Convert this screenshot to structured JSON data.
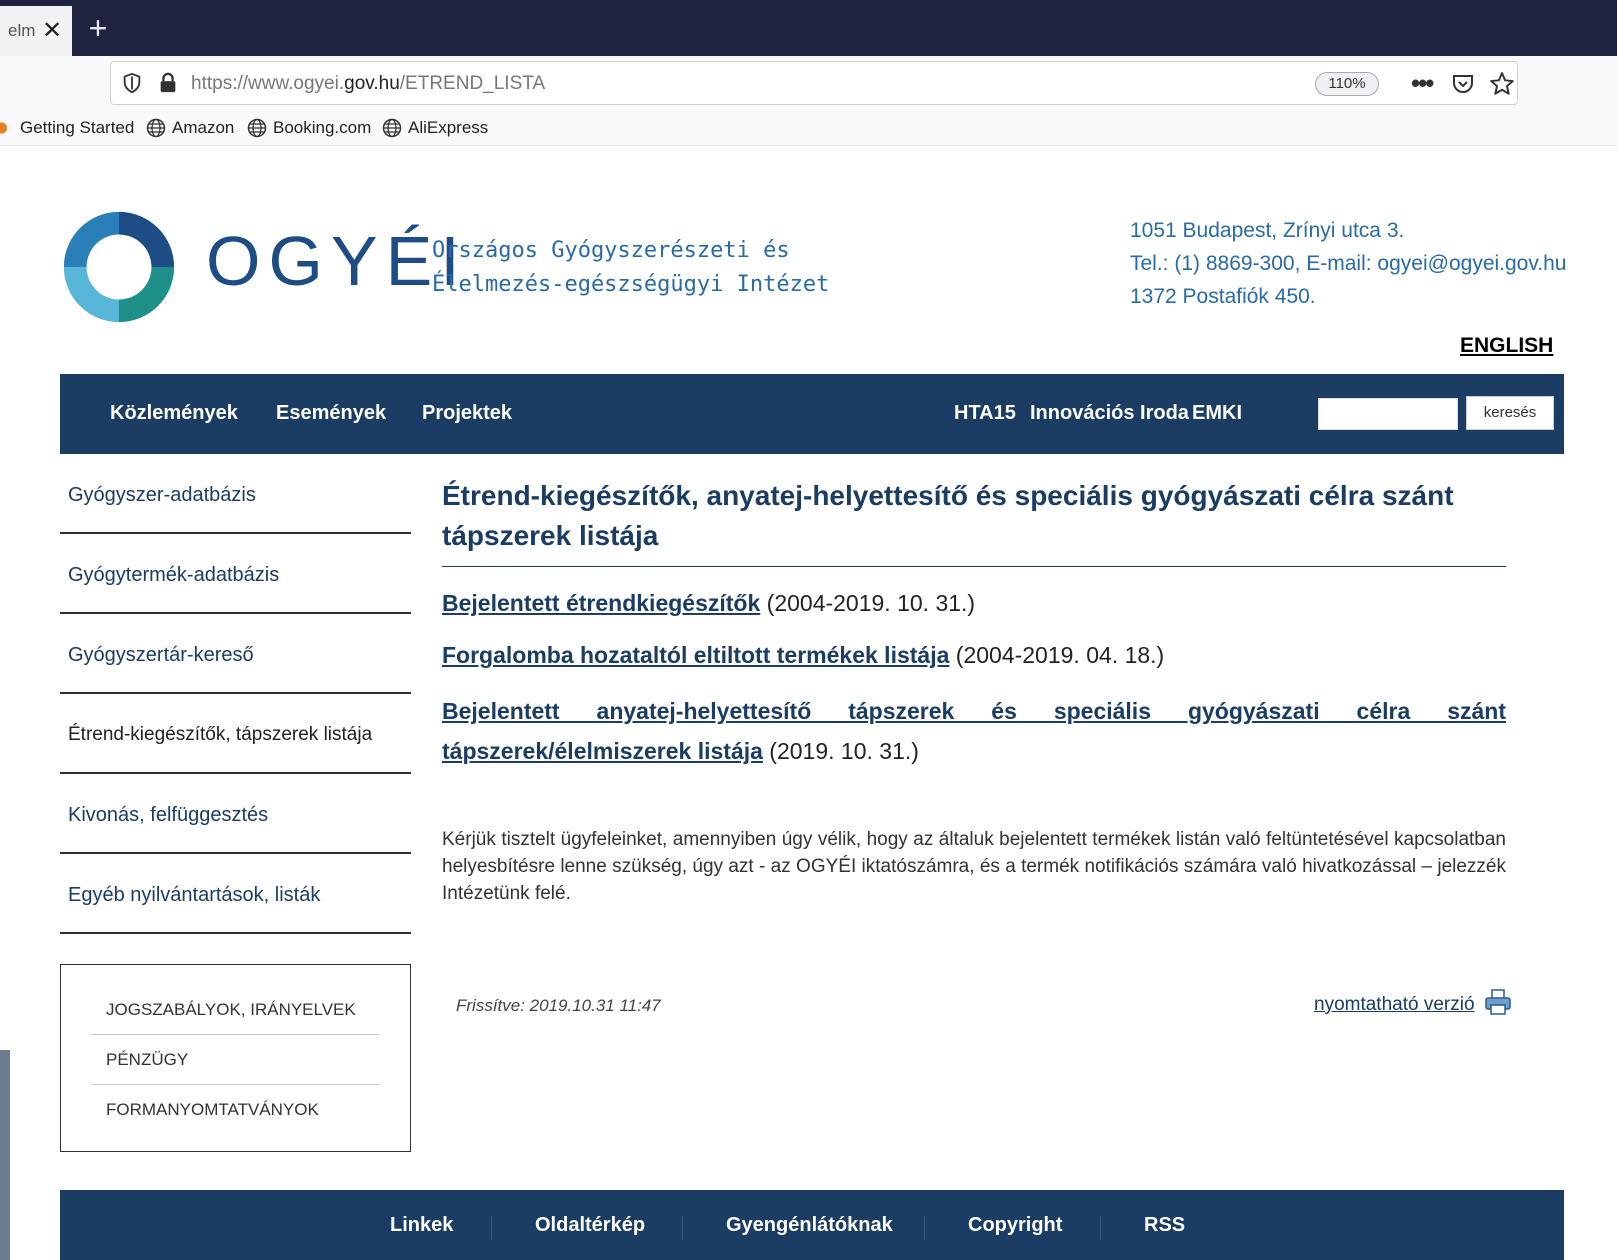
{
  "browser": {
    "tab_title": "elme",
    "url_prefix": "https://www.ogyei.",
    "url_domain": "gov.hu",
    "url_path": "/ETREND_LISTA",
    "zoom": "110%",
    "bookmarks": [
      "Getting Started",
      "Amazon",
      "Booking.com",
      "AliExpress"
    ]
  },
  "header": {
    "brand": "OGYÉI",
    "inst_line1": "Országos Gyógyszerészeti és",
    "inst_line2": "Élelmezés-egészségügyi Intézet",
    "address": "1051 Budapest, Zrínyi utca 3.",
    "phone_email": "Tel.: (1) 8869-300, E-mail: ogyei@ogyei.gov.hu",
    "postbox": "1372 Postafiók 450.",
    "english": "ENGLISH"
  },
  "nav": {
    "left": [
      "Közlemények",
      "Események",
      "Projektek"
    ],
    "right": [
      "HTA15",
      "Innovációs Iroda",
      "EMKI"
    ],
    "search_button": "keresés"
  },
  "sidebar": {
    "items": [
      "Gyógyszer-adatbázis",
      "Gyógytermék-adatbázis",
      "Gyógyszertár-kereső",
      "Étrend-kiegészítők, tápszerek listája",
      "Kivonás, felfüggesztés",
      "Egyéb nyilvántartások, listák"
    ],
    "box_items": [
      "JOGSZABÁLYOK, IRÁNYELVEK",
      "PÉNZÜGY",
      "FORMANYOMTATVÁNYOK"
    ]
  },
  "content": {
    "title": "Étrend-kiegészítők, anyatej-helyettesítő és speciális gyógyászati célra szánt tápszerek listája",
    "link1": "Bejelentett étrendkiegészítők",
    "link1_date": " (2004-2019. 10. 31.)",
    "link2": "Forgalomba hozataltól eltiltott termékek listája",
    "link2_date": " (2004-2019. 04. 18.)",
    "link3_line1": "Bejelentett anyatej-helyettesítő tápszerek és speciális gyógyászati célra szánt",
    "link3_line2": "tápszerek/élelmiszerek listája",
    "link3_date": " (2019. 10. 31.)",
    "notice": "Kérjük tisztelt ügyfeleinket, amennyiben úgy vélik, hogy az általuk bejelentett termékek listán való feltüntetésével kapcsolatban helyesbítésre lenne szükség, úgy azt - az OGYÉI iktatószámra, és a termék notifikációs számára való hivatkozással – jelezzék Intézetünk felé.",
    "updated": "Frissítve: 2019.10.31 11:47",
    "print": "nyomtatható verzió "
  },
  "footer": {
    "items": [
      "Linkek",
      "Oldaltérkép",
      "Gyengénlátóknak",
      "Copyright",
      "RSS"
    ]
  }
}
